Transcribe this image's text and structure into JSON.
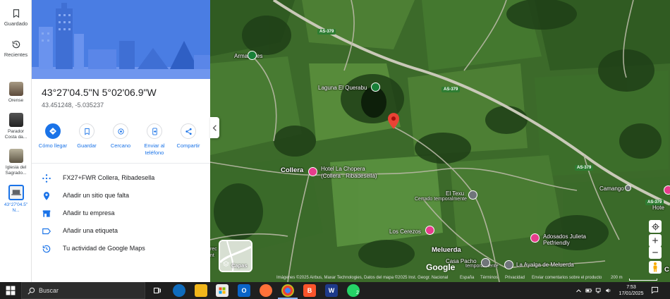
{
  "rail": {
    "saved_label": "Guardado",
    "recent_label": "Recientes",
    "recents": [
      {
        "label": "Orense",
        "color": "#7d6a55"
      },
      {
        "label": "Parador Costa da...",
        "color": "#3b3b3b"
      },
      {
        "label": "Iglesia del Sagrado...",
        "color": "#8b8570"
      },
      {
        "label": "43°27'04.5\" N...",
        "color": "#f1f3f4"
      }
    ]
  },
  "place": {
    "title": "43°27'04.5\"N 5°02'06.9\"W",
    "decimal": "43.451248, -5.035237"
  },
  "actions": [
    {
      "label": "Cómo llegar",
      "icon": "directions-icon"
    },
    {
      "label": "Guardar",
      "icon": "bookmark-icon"
    },
    {
      "label": "Cercano",
      "icon": "nearby-icon"
    },
    {
      "label": "Enviar al teléfono",
      "icon": "send-to-phone-icon"
    },
    {
      "label": "Compartir",
      "icon": "share-icon"
    }
  ],
  "info": [
    {
      "text": "FX27+FWR Collera, Ribadesella",
      "icon": "plus-code-icon"
    },
    {
      "text": "Añadir un sitio que falta",
      "icon": "add-place-icon"
    },
    {
      "text": "Añadir tu empresa",
      "icon": "business-icon"
    },
    {
      "text": "Añadir una etiqueta",
      "icon": "label-icon"
    },
    {
      "text": "Tu actividad de Google Maps",
      "icon": "history-icon"
    }
  ],
  "map": {
    "labels": {
      "armazones": "Armazones",
      "laguna": "Laguna El Querabu",
      "collera": "Collera",
      "hotel": "Hotel La Chopera\n(Collera - Ribadesella)",
      "hotel_line1": "Hotel La Chopera",
      "hotel_line2": "(Collera - Ribadesella)",
      "el_texu": "El Texu",
      "el_texu_sub": "Cerrado temporalmente",
      "los_cerezos": "Los Cerezos",
      "meluerda": "Meluerda",
      "casa_pacho": "Casa Pacho",
      "casa_pacho_sub": "temporalmente",
      "ayalga": "La Ayalga de Meluerda",
      "adosados_1": "Adosados Julieta",
      "adosados_2": "Petfriendly",
      "camango": "Camango",
      "hote": "Hote",
      "c_edge": "C",
      "rec_edge": "rec",
      "rec_edge2": "nt"
    },
    "road_shields": [
      "AS-379",
      "AS-379",
      "AS-379",
      "AS-379"
    ],
    "layers_label": "Capas",
    "google_logo": "Google",
    "attribution": "Imágenes ©2025 Airbus, Maxar Technologies, Datos del mapa ©2025 Inst. Geogr. Nacional",
    "links": [
      "España",
      "Términos",
      "Privacidad",
      "Enviar comentarios sobre el producto"
    ],
    "scale": "200 m"
  },
  "taskbar": {
    "search_placeholder": "Buscar",
    "time": "7:53",
    "date": "17/01/2025",
    "whatsapp_badge": "2"
  },
  "colors": {
    "accent": "#1a73e8",
    "hero": "#4f7fe6",
    "pin": "#ea4335"
  }
}
